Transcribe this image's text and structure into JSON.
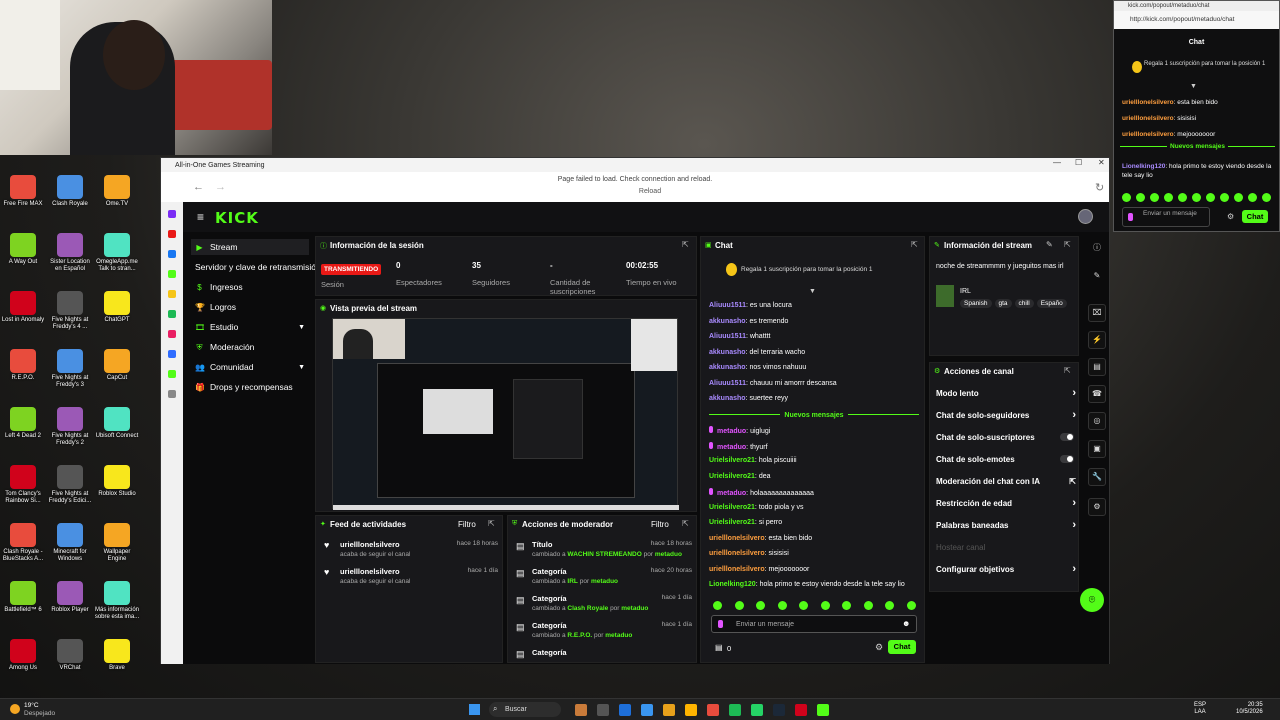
{
  "popout": {
    "tab_title": "kick.com/popout/metaduo/chat",
    "url": "http://kick.com/popout/metaduo/chat",
    "header": "Chat",
    "gift_banner": "Regala 1 suscripción para tomar la posición 1",
    "messages": [
      {
        "user": "urielllonelsilvero",
        "text": "esta bien bido"
      },
      {
        "user": "urielllonelsilvero",
        "text": "sisisisi"
      },
      {
        "user": "urielllonelsilvero",
        "text": "mejooooooor"
      }
    ],
    "new_messages": "Nuevos mensajes",
    "last": {
      "user": "Lionelking120",
      "text": "hola primo te estoy viendo desde la tele say lio"
    },
    "input_placeholder": "Enviar un mensaje",
    "chat_button": "Chat"
  },
  "window": {
    "title": "All-in-One Games Streaming",
    "nav_message": "Page failed to load. Check connection and reload.",
    "reload": "Reload"
  },
  "menu": {
    "items": [
      {
        "label": "Stream"
      },
      {
        "label": "Servidor y clave de retransmisión"
      },
      {
        "label": "Ingresos"
      },
      {
        "label": "Logros"
      },
      {
        "label": "Estudio"
      },
      {
        "label": "Moderación"
      },
      {
        "label": "Comunidad"
      },
      {
        "label": "Drops y recompensas"
      }
    ]
  },
  "session": {
    "title": "Información de la sesión",
    "live_badge": "TRANSMITIENDO",
    "session_label": "Sesión",
    "stats": [
      {
        "value": "0",
        "label": "Espectadores"
      },
      {
        "value": "35",
        "label": "Seguidores"
      },
      {
        "value": "-",
        "label": "Cantidad de suscripciones"
      },
      {
        "value": "00:02:55",
        "label": "Tiempo en vivo"
      }
    ]
  },
  "preview": {
    "title": "Vista previa del stream"
  },
  "activity": {
    "title": "Feed de actividades",
    "filter": "Filtro",
    "items": [
      {
        "user": "urielllonelsilvero",
        "sub": "acaba de seguir el canal",
        "time": "hace 18 horas"
      },
      {
        "user": "urielllonelsilvero",
        "sub": "acaba de seguir el canal",
        "time": "hace 1 día"
      }
    ]
  },
  "modactions": {
    "title": "Acciones de moderador",
    "filter": "Filtro",
    "items": [
      {
        "label": "Título",
        "changed": "cambiado a",
        "value": "WACHIN STREMEANDO",
        "by": "por",
        "mod": "metaduo",
        "time": "hace 18 horas"
      },
      {
        "label": "Categoría",
        "changed": "cambiado a",
        "value": "IRL",
        "by": "por",
        "mod": "metaduo",
        "time": "hace 20 horas"
      },
      {
        "label": "Categoría",
        "changed": "cambiado a",
        "value": "Clash Royale",
        "by": "por",
        "mod": "metaduo",
        "time": "hace 1 día"
      },
      {
        "label": "Categoría",
        "changed": "cambiado a",
        "value": "R.E.P.O.",
        "by": "por",
        "mod": "metaduo",
        "time": "hace 1 día"
      },
      {
        "label": "Categoría",
        "changed": "",
        "value": "",
        "by": "",
        "mod": "",
        "time": ""
      }
    ]
  },
  "chat": {
    "title": "Chat",
    "gift_banner": "Regala 1 suscripción para tomar la posición 1",
    "new_messages": "Nuevos mensajes",
    "messages": [
      {
        "user": "Aliuuu1511",
        "text": "es una locura",
        "color": "#a98bff"
      },
      {
        "user": "akkunasho",
        "text": "es tremendo",
        "color": "#a98bff"
      },
      {
        "user": "Aliuuu1511",
        "text": "whatttt",
        "color": "#a98bff"
      },
      {
        "user": "akkunasho",
        "text": "del terraria wacho",
        "color": "#a98bff"
      },
      {
        "user": "akkunasho",
        "text": "nos vimos nahuuu",
        "color": "#a98bff"
      },
      {
        "user": "Aliuuu1511",
        "text": "chauuu mi amorrr descansa",
        "color": "#a98bff"
      },
      {
        "user": "akkunasho",
        "text": "suertee reyy",
        "color": "#a98bff"
      }
    ],
    "messages2": [
      {
        "user": "metaduo",
        "text": "uiglugi",
        "color": "#e254ff"
      },
      {
        "user": "metaduo",
        "text": "thyurf",
        "color": "#e254ff"
      },
      {
        "user": "Urielsilvero21",
        "text": "hola piscuiiii",
        "color": "#53fc18"
      },
      {
        "user": "Urielsilvero21",
        "text": "dea",
        "color": "#53fc18"
      },
      {
        "user": "metaduo",
        "text": "holaaaaaaaaaaaaaa",
        "color": "#e254ff"
      },
      {
        "user": "Urielsilvero21",
        "text": "todo piola y vs",
        "color": "#53fc18"
      },
      {
        "user": "Urielsilvero21",
        "text": "si perro",
        "color": "#53fc18"
      },
      {
        "user": "urielllonelsilvero",
        "text": "esta bien bido",
        "color": "#ff9f3f"
      },
      {
        "user": "urielllonelsilvero",
        "text": "sisisisi",
        "color": "#ff9f3f"
      },
      {
        "user": "urielllonelsilvero",
        "text": "mejooooooor",
        "color": "#ff9f3f"
      },
      {
        "user": "Lionelking120",
        "text": "hola primo te estoy viendo desde la tele say lio",
        "color": "#53fc18"
      }
    ],
    "input_placeholder": "Enviar un mensaje",
    "chat_button": "Chat",
    "count": "0"
  },
  "streaminfo": {
    "title": "Información del stream",
    "stream_title": "noche de streammmm y jueguitos mas irl",
    "category": "IRL",
    "tags": [
      "Spanish",
      "gta",
      "chill",
      "Españo"
    ]
  },
  "channel": {
    "title": "Acciones de canal",
    "rows": [
      {
        "label": "Modo lento",
        "ctl": "chevron"
      },
      {
        "label": "Chat de solo-seguidores",
        "ctl": "chevron"
      },
      {
        "label": "Chat de solo-suscriptores",
        "ctl": "toggle"
      },
      {
        "label": "Chat de solo-emotes",
        "ctl": "toggle"
      },
      {
        "label": "Moderación del chat con IA",
        "ctl": "link"
      },
      {
        "label": "Restricción de edad",
        "ctl": "chevron"
      },
      {
        "label": "Palabras baneadas",
        "ctl": "chevron"
      },
      {
        "label": "Hostear canal",
        "ctl": "none",
        "disabled": true
      },
      {
        "label": "Configurar objetivos",
        "ctl": "chevron"
      }
    ]
  },
  "desktop": {
    "icons": [
      "Free Fire MAX",
      "Clash Royale",
      "Ome.TV",
      "A Way Out",
      "Sister Location en Español",
      "OmegleApp.me Talk to stran...",
      "Lost in Anomaly",
      "Five Nights at Freddy's 4 ...",
      "ChatGPT",
      "R.E.P.O.",
      "Five Nights at Freddy's 3",
      "CapCut",
      "Left 4 Dead 2",
      "Five Nights at Freddy's 2",
      "Ubisoft Connect",
      "Tom Clancy's Rainbow Si...",
      "Five Nights at Freddy's Edici...",
      "Roblox Studio",
      "Clash Royale - BlueStacks A...",
      "Minecraft for Windows",
      "Wallpaper Engine",
      "Battlefield™ 6",
      "Roblox Player",
      "Más información sobre esta ima...",
      "Among Us",
      "VRChat",
      "Brave"
    ]
  },
  "taskbar": {
    "weather_temp": "19°C",
    "weather_text": "Despejado",
    "search": "Buscar",
    "lang1": "ESP",
    "lang2": "LAA",
    "time": "20:35",
    "date": "10/5/2026"
  }
}
